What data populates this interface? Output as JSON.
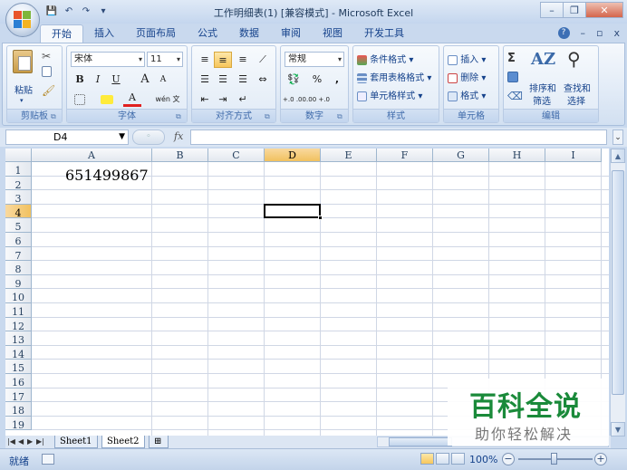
{
  "window": {
    "title": "工作明细表(1)  [兼容模式] - Microsoft Excel",
    "minimize": "–",
    "restore": "❐",
    "close": "✕"
  },
  "qat": {
    "save": "💾",
    "undo": "↶",
    "redo": "↷",
    "more": "▾"
  },
  "tabs": [
    {
      "label": "开始",
      "active": true
    },
    {
      "label": "插入"
    },
    {
      "label": "页面布局"
    },
    {
      "label": "公式"
    },
    {
      "label": "数据"
    },
    {
      "label": "审阅"
    },
    {
      "label": "视图"
    },
    {
      "label": "开发工具"
    }
  ],
  "tab_right": {
    "help": "?",
    "min": "–",
    "restore": "▫",
    "close": "x"
  },
  "ribbon": {
    "clipboard": {
      "label": "剪贴板",
      "paste": "粘贴"
    },
    "font": {
      "label": "字体",
      "name": "宋体",
      "size": "11",
      "bold": "B",
      "italic": "I",
      "underline": "U",
      "grow": "A",
      "shrink": "A",
      "fontcolor": "A",
      "phonetic": "wén 文"
    },
    "alignment": {
      "label": "对齐方式"
    },
    "number": {
      "label": "数字",
      "format": "常规",
      "percent": "%",
      "comma": ",",
      "inc_dec": "+.0 .00",
      "dec_dec": ".00 +.0"
    },
    "styles": {
      "label": "样式",
      "cond": "条件格式",
      "table": "套用表格格式",
      "cell": "单元格样式"
    },
    "cells": {
      "label": "单元格",
      "insert": "插入",
      "delete": "删除",
      "format": "格式"
    },
    "editing": {
      "label": "编辑",
      "sigma": "Σ",
      "sort": "排序和",
      "sort2": "筛选",
      "find": "查找和",
      "find2": "选择"
    }
  },
  "formula_bar": {
    "name_box": "D4",
    "fx": "fx",
    "content": ""
  },
  "columns": [
    "A",
    "B",
    "C",
    "D",
    "E",
    "F",
    "G",
    "H",
    "I"
  ],
  "rows": [
    "1",
    "2",
    "3",
    "4",
    "5",
    "6",
    "7",
    "8",
    "9",
    "10",
    "11",
    "12",
    "13",
    "14",
    "15",
    "16",
    "17",
    "18",
    "19"
  ],
  "cells": {
    "A1": "651499867"
  },
  "active_cell": "D4",
  "sheets": [
    "Sheet1",
    "Sheet2"
  ],
  "active_sheet": "Sheet2",
  "status": {
    "ready": "就绪",
    "zoom": "100%"
  },
  "watermark": {
    "main": "百科全说",
    "sub": "助你轻松解决"
  },
  "colors": {
    "accent": "#15428b",
    "selected_header": "#f1c15f",
    "watermark": "#1a8a3a"
  }
}
